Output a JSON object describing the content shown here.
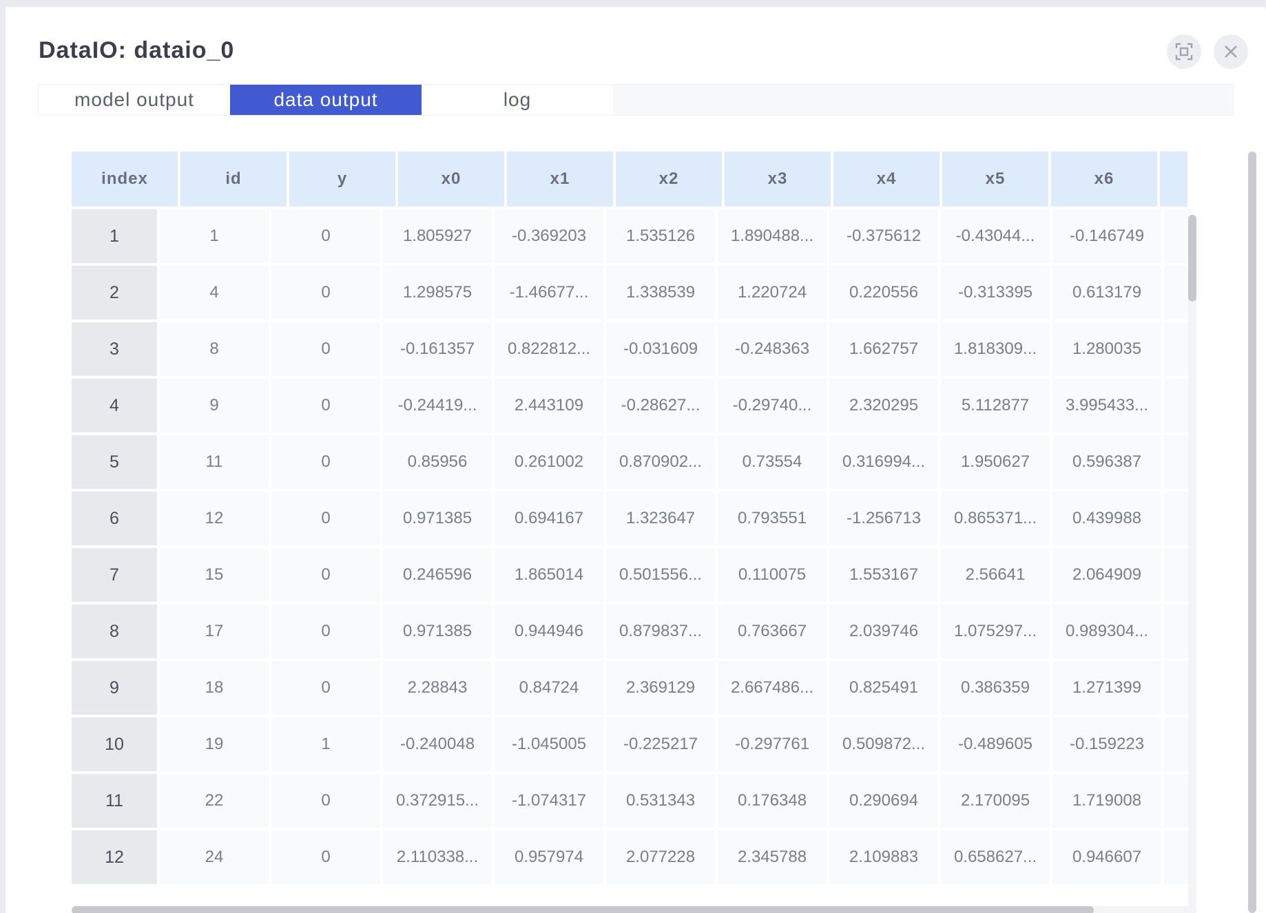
{
  "dialog": {
    "title": "DataIO: dataio_0",
    "fullscreen_icon": "fullscreen-icon",
    "close_icon": "close-icon"
  },
  "tabs": [
    {
      "label": "model output",
      "active": false
    },
    {
      "label": "data output",
      "active": true
    },
    {
      "label": "log",
      "active": false
    }
  ],
  "table": {
    "columns": [
      "index",
      "id",
      "y",
      "x0",
      "x1",
      "x2",
      "x3",
      "x4",
      "x5",
      "x6"
    ],
    "rows": [
      [
        "1",
        "1",
        "0",
        "1.805927",
        "-0.369203",
        "1.535126",
        "1.890488...",
        "-0.375612",
        "-0.43044...",
        "-0.146749"
      ],
      [
        "2",
        "4",
        "0",
        "1.298575",
        "-1.46677...",
        "1.338539",
        "1.220724",
        "0.220556",
        "-0.313395",
        "0.613179"
      ],
      [
        "3",
        "8",
        "0",
        "-0.161357",
        "0.822812...",
        "-0.031609",
        "-0.248363",
        "1.662757",
        "1.818309...",
        "1.280035"
      ],
      [
        "4",
        "9",
        "0",
        "-0.24419...",
        "2.443109",
        "-0.28627...",
        "-0.29740...",
        "2.320295",
        "5.112877",
        "3.995433..."
      ],
      [
        "5",
        "11",
        "0",
        "0.85956",
        "0.261002",
        "0.870902...",
        "0.73554",
        "0.316994...",
        "1.950627",
        "0.596387"
      ],
      [
        "6",
        "12",
        "0",
        "0.971385",
        "0.694167",
        "1.323647",
        "0.793551",
        "-1.256713",
        "0.865371...",
        "0.439988"
      ],
      [
        "7",
        "15",
        "0",
        "0.246596",
        "1.865014",
        "0.501556...",
        "0.110075",
        "1.553167",
        "2.56641",
        "2.064909"
      ],
      [
        "8",
        "17",
        "0",
        "0.971385",
        "0.944946",
        "0.879837...",
        "0.763667",
        "2.039746",
        "1.075297...",
        "0.989304..."
      ],
      [
        "9",
        "18",
        "0",
        "2.28843",
        "0.84724",
        "2.369129",
        "2.667486...",
        "0.825491",
        "0.386359",
        "1.271399"
      ],
      [
        "10",
        "19",
        "1",
        "-0.240048",
        "-1.045005",
        "-0.225217",
        "-0.297761",
        "0.509872...",
        "-0.489605",
        "-0.159223"
      ],
      [
        "11",
        "22",
        "0",
        "0.372915...",
        "-1.074317",
        "0.531343",
        "0.176348",
        "0.290694",
        "2.170095",
        "1.719008"
      ],
      [
        "12",
        "24",
        "0",
        "2.110338...",
        "0.957974",
        "2.077228",
        "2.345788",
        "2.109883",
        "0.658627...",
        "0.946607"
      ]
    ]
  },
  "colors": {
    "accent": "#4159d1",
    "header_bg": "#deebfb",
    "index_bg": "#e8e9ec"
  }
}
